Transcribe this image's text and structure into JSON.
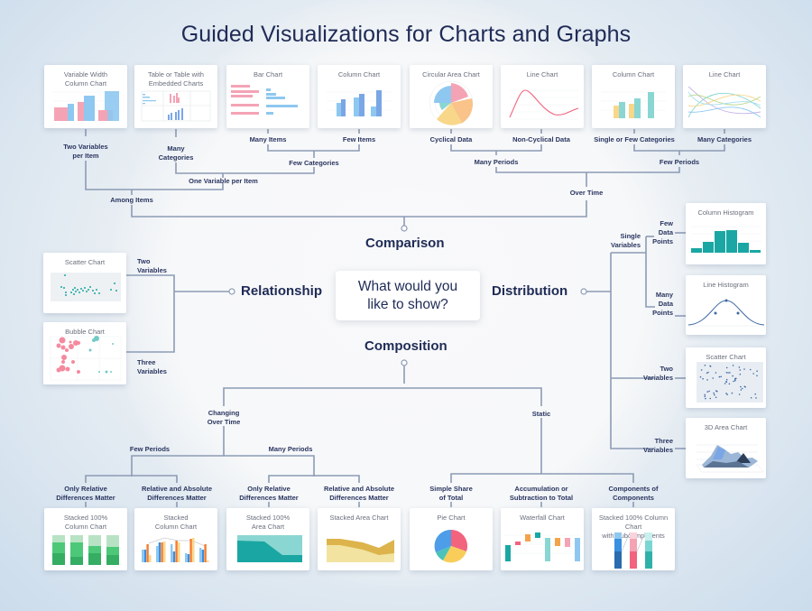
{
  "title": "Guided Visualizations for Charts and Graphs",
  "center_question": "What would you\nlike to show?",
  "categories": {
    "comparison": "Comparison",
    "relationship": "Relationship",
    "distribution": "Distribution",
    "composition": "Composition"
  },
  "comparison": {
    "cards": [
      {
        "title": "Variable Width\nColumn Chart"
      },
      {
        "title": "Table or Table with\nEmbedded Charts"
      },
      {
        "title": "Bar Chart"
      },
      {
        "title": "Column Chart"
      },
      {
        "title": "Circular Area Chart"
      },
      {
        "title": "Line Chart"
      },
      {
        "title": "Column Chart"
      },
      {
        "title": "Line Chart"
      }
    ],
    "labels": {
      "two_variables_per_item": "Two Variables\nper Item",
      "many_categories": "Many\nCategories",
      "many_items": "Many Items",
      "few_items": "Few Items",
      "few_categories": "Few Categories",
      "one_variable_per_item": "One Variable per Item",
      "among_items": "Among Items",
      "cyclical_data": "Cyclical Data",
      "non_cyclical_data": "Non-Cyclical Data",
      "single_or_few_categories": "Single or Few Categories",
      "many_categories_time": "Many Categories",
      "many_periods": "Many Periods",
      "few_periods": "Few Periods",
      "over_time": "Over Time"
    }
  },
  "relationship": {
    "cards": [
      {
        "title": "Scatter Chart"
      },
      {
        "title": "Bubble Chart"
      }
    ],
    "labels": {
      "two_variables": "Two\nVariables",
      "three_variables": "Three\nVariables"
    }
  },
  "distribution": {
    "cards": [
      {
        "title": "Column Histogram"
      },
      {
        "title": "Line Histogram"
      },
      {
        "title": "Scatter Chart"
      },
      {
        "title": "3D Area Chart"
      }
    ],
    "labels": {
      "single_variables": "Single\nVariables",
      "few_data_points": "Few\nData\nPoints",
      "many_data_points": "Many\nData\nPoints",
      "two_variables": "Two\nVariables",
      "three_variables": "Three\nVariables"
    }
  },
  "composition": {
    "cards": [
      {
        "title": "Stacked 100%\nColumn Chart"
      },
      {
        "title": "Stacked\nColumn Chart"
      },
      {
        "title": "Stacked 100%\nArea Chart"
      },
      {
        "title": "Stacked Area Chart"
      },
      {
        "title": "Pie Chart"
      },
      {
        "title": "Waterfall Chart"
      },
      {
        "title": "Stacked 100% Column Chart\nwith Subcomponents"
      }
    ],
    "labels": {
      "changing_over_time": "Changing\nOver Time",
      "static": "Static",
      "few_periods": "Few Periods",
      "many_periods": "Many Periods",
      "only_relative_1": "Only Relative\nDifferences Matter",
      "relative_absolute_1": "Relative and Absolute\nDifferences Matter",
      "only_relative_2": "Only Relative\nDifferences Matter",
      "relative_absolute_2": "Relative and Absolute\nDifferences Matter",
      "simple_share": "Simple Share\nof Total",
      "accumulation": "Accumulation or\nSubtraction to Total",
      "components": "Components of\nComponents"
    }
  },
  "colors": {
    "navy": "#1f2b56",
    "connector": "#8c9bb5",
    "pink": "#f4a3b5",
    "blue": "#8ec8f0",
    "teal": "#1aa7a3",
    "yellow": "#f8d78a",
    "green": "#3cbf6a",
    "orange": "#f5a34a",
    "red": "#f2637e"
  }
}
